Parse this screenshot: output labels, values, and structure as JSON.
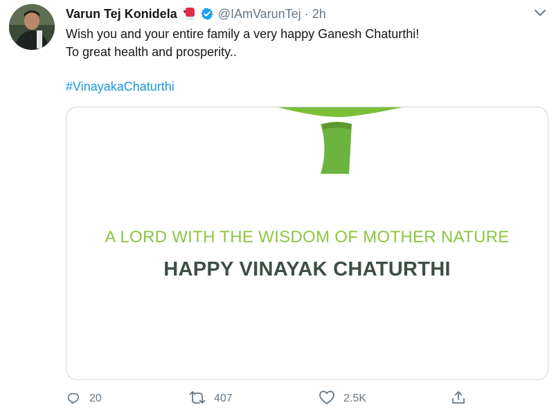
{
  "tweet": {
    "author_name": "Varun Tej Konidela",
    "handle": "@IAmVarunTej",
    "separator": "·",
    "timestamp": "2h",
    "text_lines": [
      "Wish you and your entire family a very happy Ganesh Chaturthi!",
      "To great health and prosperity.."
    ],
    "hashtag": "#VinayakaChaturthi",
    "card": {
      "tagline": "A LORD WITH THE WISDOM OF MOTHER NATURE",
      "headline": "HAPPY VINAYAK CHATURTHI"
    },
    "actions": {
      "reply_count": "20",
      "retweet_count": "407",
      "like_count": "2.5K"
    }
  },
  "colors": {
    "text": "#14171a",
    "secondary": "#657786",
    "link": "#1b95e0",
    "verified": "#1da1f2",
    "card_border": "#ccd6dd",
    "tagline_green": "#8cc63f",
    "headline_dark": "#3d4f45"
  },
  "icons": {
    "avatar": "profile-photo",
    "badge_emoji": "boxing-glove-icon",
    "verified": "verified-badge-icon",
    "caret": "chevron-down-icon",
    "reply": "reply-icon",
    "retweet": "retweet-icon",
    "like": "heart-icon",
    "share": "share-icon"
  }
}
